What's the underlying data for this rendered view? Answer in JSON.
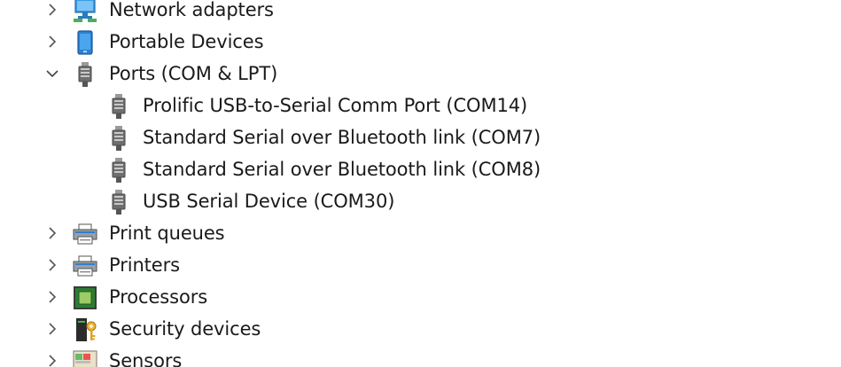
{
  "tree": {
    "network_adapters": "Network adapters",
    "portable_devices": "Portable Devices",
    "ports": "Ports (COM & LPT)",
    "port_children": [
      "Prolific USB-to-Serial Comm Port (COM14)",
      "Standard Serial over Bluetooth link (COM7)",
      "Standard Serial over Bluetooth link (COM8)",
      "USB Serial Device (COM30)"
    ],
    "print_queues": "Print queues",
    "printers": "Printers",
    "processors": "Processors",
    "security_devices": "Security devices",
    "sensors": "Sensors"
  },
  "icons": {
    "network_adapters": "network-adapter-icon",
    "portable_devices": "portable-device-icon",
    "ports": "port-connector-icon",
    "print_queues": "printer-icon",
    "printers": "printer-icon",
    "processors": "processor-chip-icon",
    "security_devices": "security-key-icon",
    "sensors": "sensor-icon"
  }
}
